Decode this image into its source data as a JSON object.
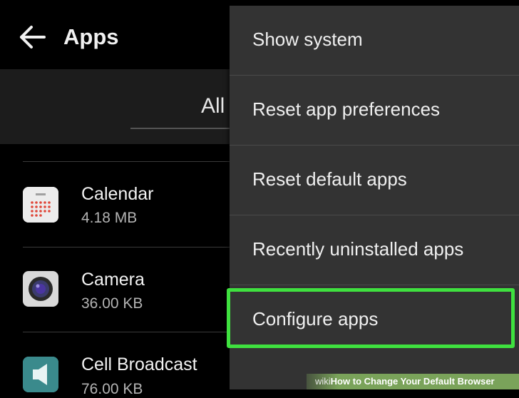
{
  "header": {
    "title": "Apps"
  },
  "filter": {
    "label": "All"
  },
  "apps": [
    {
      "name": "Calendar",
      "size": "4.18 MB",
      "icon": "calendar-icon"
    },
    {
      "name": "Camera",
      "size": "36.00 KB",
      "icon": "camera-icon"
    },
    {
      "name": "Cell Broadcast",
      "size": "76.00 KB",
      "icon": "megaphone-icon"
    }
  ],
  "menu": {
    "items": [
      {
        "label": "Show system"
      },
      {
        "label": "Reset app preferences"
      },
      {
        "label": "Reset default apps"
      },
      {
        "label": "Recently uninstalled apps"
      },
      {
        "label": "Configure apps"
      }
    ]
  },
  "watermark": {
    "wiki": "wiki",
    "how": "How",
    "rest": " to Change Your Default Browser"
  },
  "colors": {
    "highlight": "#3fe13f",
    "menu_bg": "#333333",
    "background": "#000000"
  }
}
